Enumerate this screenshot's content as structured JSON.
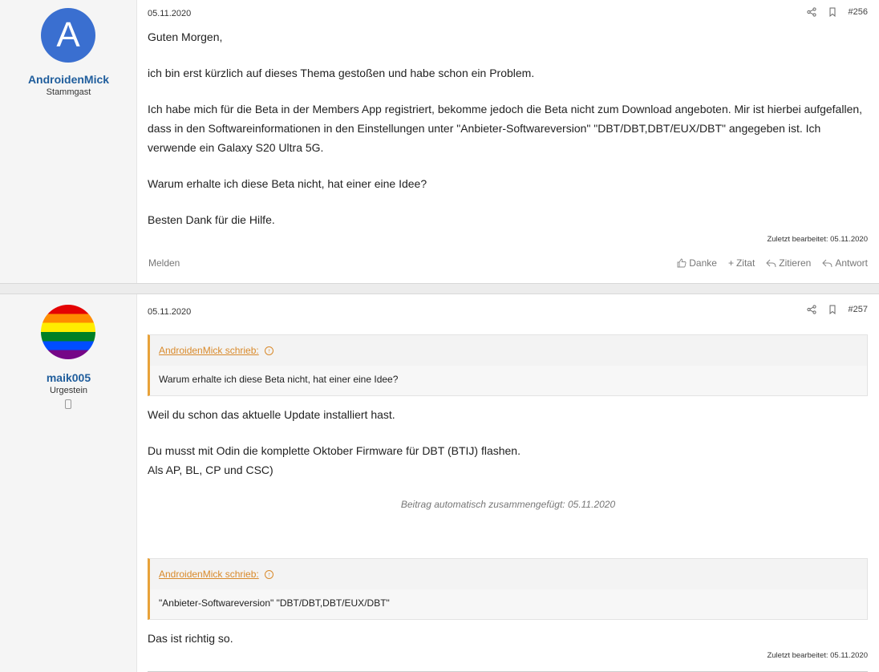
{
  "posts": [
    {
      "username": "AndroidenMick",
      "user_title": "Stammgast",
      "avatar_letter": "A",
      "avatar_color": "#3a6fd0",
      "date": "05.11.2020",
      "post_number": "#256",
      "paragraphs": [
        "Guten Morgen,",
        "ich bin erst kürzlich auf dieses Thema gestoßen und habe schon ein Problem.",
        "Ich habe mich für die Beta in der Members App registriert, bekomme jedoch die Beta nicht zum Download angeboten. Mir ist hierbei aufgefallen, dass in den Softwareinformationen in den Einstellungen unter \"Anbieter-Softwareversion\" \"DBT/DBT,DBT/EUX/DBT\" angegeben ist. Ich verwende ein Galaxy S20 Ultra 5G.",
        "Warum erhalte ich diese Beta nicht, hat einer eine Idee?",
        "Besten Dank für die Hilfe."
      ],
      "last_edited": "Zuletzt bearbeitet: 05.11.2020",
      "report_label": "Melden",
      "actions": {
        "like": "Danke",
        "quote": "Zitat",
        "multiquote": "Zitieren",
        "reply": "Antwort"
      }
    },
    {
      "username": "maik005",
      "user_title": "Urgestein",
      "date": "05.11.2020",
      "post_number": "#257",
      "quotes": [
        {
          "author": "AndroidenMick schrieb:",
          "text": "Warum erhalte ich diese Beta nicht, hat einer eine Idee?"
        },
        {
          "author": "AndroidenMick schrieb:",
          "text": "\"Anbieter-Softwareversion\" \"DBT/DBT,DBT/EUX/DBT\""
        }
      ],
      "reply1_line1": "Weil du schon das aktuelle Update installiert hast.",
      "reply1_line2": "Du musst mit Odin die komplette Oktober Firmware für DBT (BTIJ) flashen.",
      "reply1_line3": "Als AP, BL, CP und CSC)",
      "merged_note": "Beitrag automatisch zusammengefügt: 05.11.2020",
      "reply2": "Das ist richtig so.",
      "last_edited": "Zuletzt bearbeitet: 05.11.2020"
    }
  ],
  "colors": {
    "username": "#1f5d9c",
    "quote_accent": "#e8a23a",
    "sidebar_bg": "#f5f5f5"
  }
}
